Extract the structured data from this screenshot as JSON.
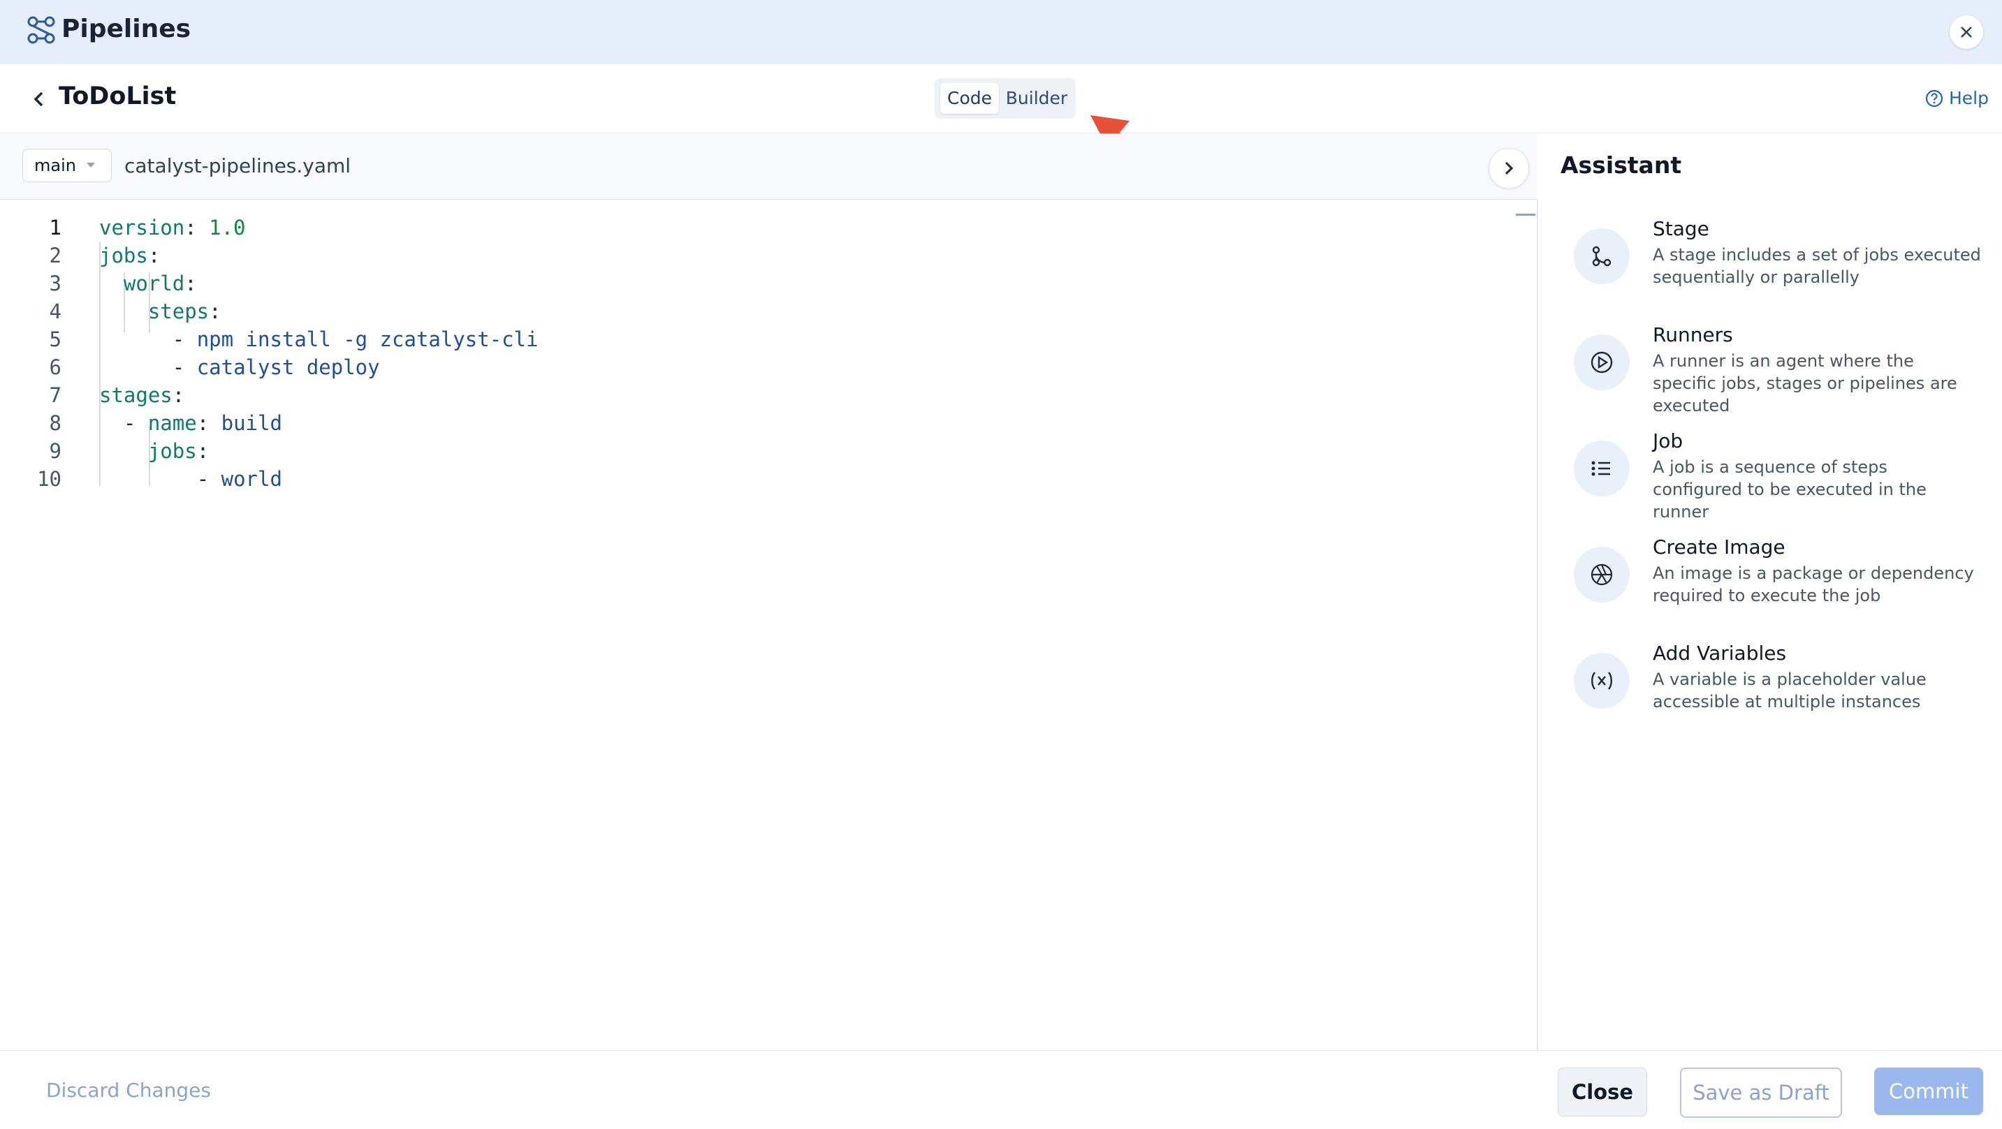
{
  "app": {
    "title": "Pipelines",
    "icon": "pipelines-icon"
  },
  "header": {
    "project_name": "ToDoList",
    "mode_tabs": [
      "Code",
      "Builder"
    ],
    "active_tab": "Code",
    "help_label": "Help"
  },
  "editor": {
    "branch": "main",
    "file_name": "catalyst-pipelines.yaml",
    "lines": [
      {
        "n": "1",
        "text": "version: 1.0"
      },
      {
        "n": "2",
        "text": "jobs:"
      },
      {
        "n": "3",
        "text": "world:"
      },
      {
        "n": "4",
        "text": "steps:"
      },
      {
        "n": "5",
        "text": "- npm install -g zcatalyst-cli"
      },
      {
        "n": "6",
        "text": "- catalyst deploy"
      },
      {
        "n": "7",
        "text": "stages:"
      },
      {
        "n": "8",
        "text": "- name: build"
      },
      {
        "n": "9",
        "text": "jobs:"
      },
      {
        "n": "10",
        "text": "- world"
      }
    ]
  },
  "assistant": {
    "title": "Assistant",
    "items": [
      {
        "name": "Stage",
        "desc": "A stage includes a set of jobs executed sequentially or parallelly",
        "icon": "stage-icon"
      },
      {
        "name": "Runners",
        "desc": "A runner is an agent where the specific jobs, stages or pipelines are executed",
        "icon": "runner-play-icon"
      },
      {
        "name": "Job",
        "desc": "A job is a sequence of steps configured to be executed in the runner",
        "icon": "job-list-icon"
      },
      {
        "name": "Create Image",
        "desc": "An image is a package or dependency required to execute the job",
        "icon": "aperture-icon"
      },
      {
        "name": "Add Variables",
        "desc": "A variable is a placeholder value accessible at multiple instances",
        "icon": "variable-icon"
      }
    ]
  },
  "footer": {
    "discard_label": "Discard Changes",
    "close_label": "Close",
    "draft_label": "Save as Draft",
    "commit_label": "Commit"
  },
  "colors": {
    "topbar_bg": "#e6eefb",
    "accent": "#2563b8",
    "commit_bg": "#9bb8ee",
    "annotation_arrow": "#e8503a"
  }
}
